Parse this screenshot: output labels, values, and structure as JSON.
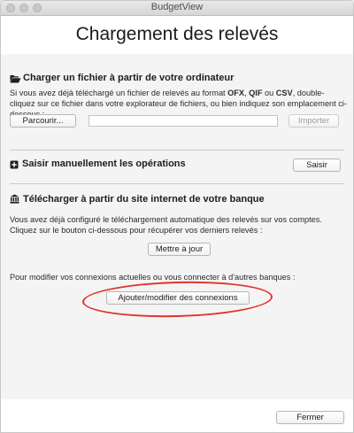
{
  "window": {
    "title": "BudgetView"
  },
  "header": {
    "title": "Chargement des relevés"
  },
  "file_section": {
    "title": "Charger un fichier à partir de votre ordinateur",
    "desc_prefix": "Si vous avez déjà téléchargé un fichier de relevés au format ",
    "fmt1": "OFX",
    "sep1": ", ",
    "fmt2": "QIF",
    "sep2": " ou ",
    "fmt3": "CSV",
    "desc_suffix": ", double-cliquez sur ce fichier dans votre explorateur de fichiers, ou bien indiquez son emplacement ci-dessous :",
    "browse_label": "Parcourir...",
    "path_value": "",
    "import_label": "Importer"
  },
  "manual_section": {
    "title": "Saisir manuellement les opérations",
    "enter_label": "Saisir"
  },
  "bank_section": {
    "title": "Télécharger à partir du site internet de votre banque",
    "description": "Vous avez déjà configuré le téléchargement automatique des relevés sur vos comptes. Cliquez sur le bouton ci-dessous pour récupérer vos derniers relevés :",
    "update_label": "Mettre à jour",
    "connections_text": "Pour modifier vos connexions actuelles ou vous connecter à d'autres banques :",
    "connections_label": "Ajouter/modifier des connexions"
  },
  "footer": {
    "close_label": "Fermer"
  },
  "colors": {
    "annotation": "#e2322b"
  },
  "icons": {
    "file_section": "folder-open-icon",
    "manual_section": "plus-square-icon",
    "bank_section": "bank-icon"
  }
}
